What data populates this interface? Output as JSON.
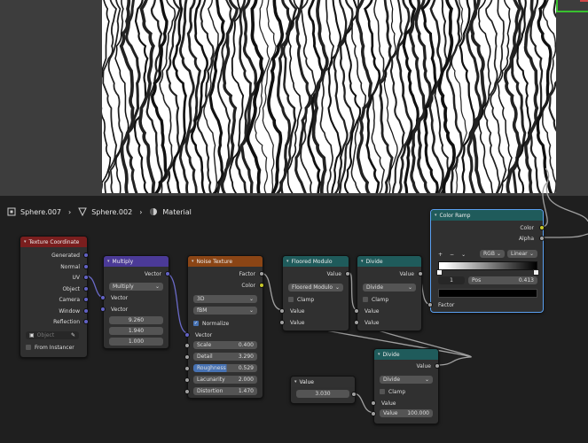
{
  "breadcrumb": {
    "object": "Sphere.007",
    "mesh": "Sphere.002",
    "material": "Material"
  },
  "nodes": {
    "texcoord": {
      "title": "Texture Coordinate",
      "outputs": [
        "Generated",
        "Normal",
        "UV",
        "Object",
        "Camera",
        "Window",
        "Reflection"
      ],
      "object_placeholder": "Object",
      "from_instancer": "From Instancer"
    },
    "multiply": {
      "title": "Multiply",
      "output": "Vector",
      "mode": "Multiply",
      "in1": "Vector",
      "in2": "Vector",
      "vals": [
        "9.260",
        "1.940",
        "1.000"
      ]
    },
    "noise": {
      "title": "Noise Texture",
      "out_factor": "Factor",
      "out_color": "Color",
      "dim": "3D",
      "type": "fBM",
      "normalize": "Normalize",
      "in_vector": "Vector",
      "params": [
        {
          "label": "Scale",
          "value": "0.400"
        },
        {
          "label": "Detail",
          "value": "3.290"
        },
        {
          "label": "Roughness",
          "value": "0.529"
        },
        {
          "label": "Lacunarity",
          "value": "2.000"
        },
        {
          "label": "Distortion",
          "value": "1.470"
        }
      ]
    },
    "floored": {
      "title": "Floored Modulo",
      "out": "Value",
      "mode": "Floored Modulo",
      "clamp": "Clamp",
      "in1": "Value",
      "in2": "Value"
    },
    "divide1": {
      "title": "Divide",
      "out": "Value",
      "mode": "Divide",
      "clamp": "Clamp",
      "in1": "Value",
      "in2": "Value"
    },
    "colorramp": {
      "title": "Color Ramp",
      "out_color": "Color",
      "out_alpha": "Alpha",
      "plus": "+",
      "minus": "−",
      "mode": "RGB",
      "interp": "Linear",
      "index": "1",
      "pos_label": "Pos",
      "pos_value": "0.413",
      "in_factor": "Factor"
    },
    "divide2": {
      "title": "Divide",
      "out": "Value",
      "mode": "Divide",
      "clamp": "Clamp",
      "in1": "Value",
      "in2_label": "Value",
      "in2_value": "100.000"
    },
    "value": {
      "title": "Value",
      "out": "Value",
      "value": "3.030"
    }
  },
  "colors": {
    "input": "#7a1e1e",
    "converter": "#1f5b5b",
    "vector": "#4b3a97",
    "texture": "#8b4515",
    "selected_border": "#5aa0f0"
  },
  "icons": {
    "object": "triangle-object-icon",
    "mesh": "mesh-icon",
    "material": "material-sphere-icon"
  }
}
